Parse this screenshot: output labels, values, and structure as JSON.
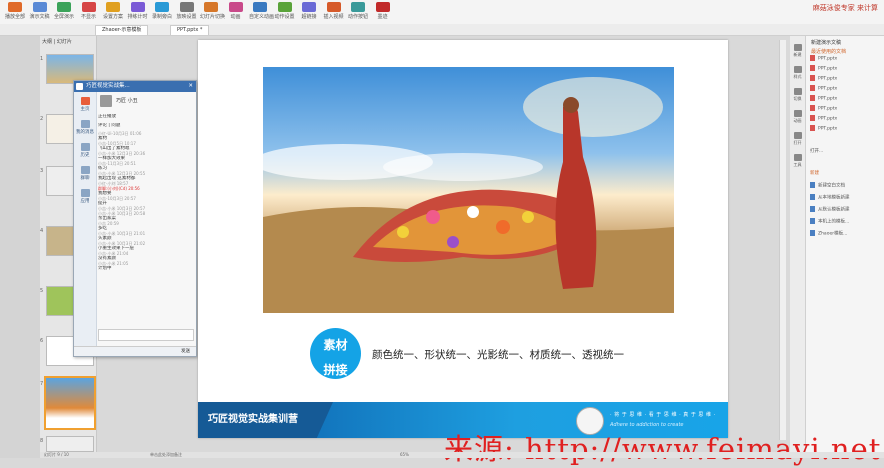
{
  "ribbon": {
    "items": [
      "播放全部",
      "演示文稿",
      "全屏演示",
      "不显示",
      "设置方案",
      "排练计时",
      "录制旁白",
      "放映设置",
      "幻灯片切换",
      "动画",
      "自定义动画",
      "动作设置",
      "超链接",
      "插入视频",
      "动作按钮",
      "墨迹"
    ],
    "brand": "麻菇泳俊专家 来计算"
  },
  "tabs": {
    "tab1": "Zhaoer-示意模板",
    "tab2": "PPT.pptx *"
  },
  "left_panel": {
    "label": "大纲 | 幻灯片",
    "slide_numbers": [
      "1",
      "2",
      "3",
      "4",
      "5",
      "6",
      "7",
      "8"
    ]
  },
  "chat": {
    "title": "巧匠视觉实战集...",
    "side": [
      "主页",
      "我的消息",
      "历史",
      "群聊",
      "应用"
    ],
    "contact": "巧匠 小丑",
    "section": "正在播放",
    "tab_labels": "评论 | 问题",
    "messages": [
      "小红-Ui-10月3日 01:06",
      "素材",
      "小吉-10月5日 10:17",
      "飞山出了素材嗯",
      "小吉-小米 12月3日 20:36",
      "一样加大效果",
      "小吉-11月3日 20:51",
      "练习",
      "小吉-小米 12月3日 20:55",
      "我起出现 这素材都",
      "小红-小刘 18:57",
      "群聊:(小刘)(Cd) 20:56",
      "我想要",
      "小吉-10月3日 20:57",
      "提升",
      "小吉-小米 10月3日 20:57",
      "小吉-小米 10月3日 20:58",
      "亲出家菜",
      "小吉 20:59",
      "多吃",
      "小吉-小米 10月3日 21:01",
      "头素颜",
      "小吉-小米 10月3日 21:02",
      "小重生效果下一层",
      "小吉-小米 21:04",
      "没有素颜",
      "小吉-小米 21:05",
      "计划中"
    ],
    "footer": "发送"
  },
  "slide": {
    "circle_line1": "素材",
    "circle_line2": "拼接",
    "body": "颜色统一、形状统一、光影统一、材质统一、透视统一",
    "banner_title": "巧匠视觉实战集训营",
    "slogan1": "· 将 于 思 维 · 看 于 思 维 · 真 于 思 维 ·",
    "slogan2": "Adhere to addiction to create"
  },
  "right_panel": {
    "title": "新建演示文稿",
    "recent_label": "最近使用的文档",
    "files": [
      "PPT.pptx",
      "PPT.pptx",
      "PPT.pptx",
      "PPT.pptx",
      "PPT.pptx",
      "PPT.pptx",
      "PPT.pptx",
      "PPT.pptx"
    ],
    "open_label": "打开...",
    "new_label": "新建",
    "tasks": [
      "新建空白文档",
      "从本地模板新建",
      "从默认模板新建",
      "本机上的模板...",
      "Zhaoer模板..."
    ],
    "strip": [
      "新建",
      "样式",
      "切换",
      "动画",
      "打开",
      "工具"
    ]
  },
  "status": {
    "left": "幻灯片 9 / 10",
    "mid": "单击此处添加备注",
    "zoom": "65%"
  },
  "watermark": "来源: http://www.feimayi.net"
}
